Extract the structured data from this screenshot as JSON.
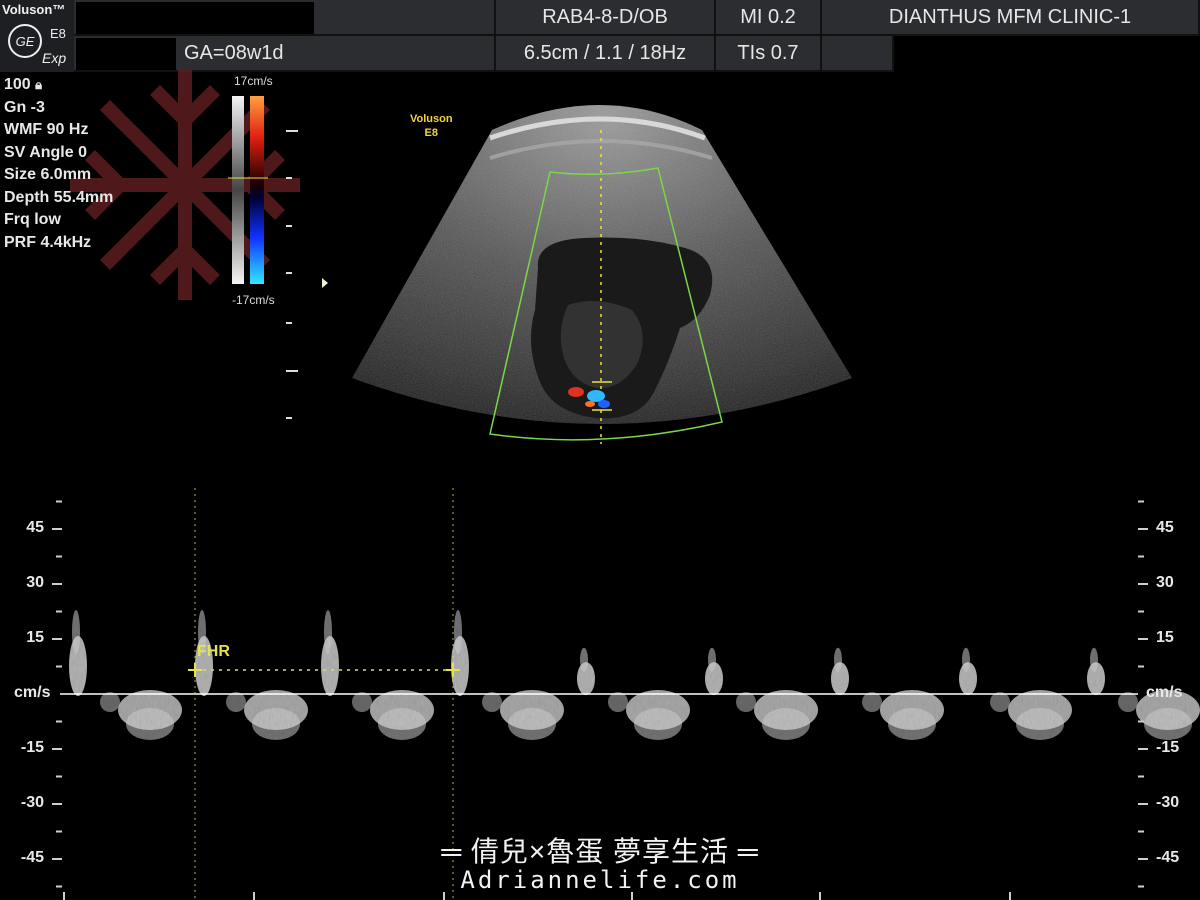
{
  "header": {
    "brand_name": "Voluson™",
    "brand_model": "E8",
    "brand_mode": "Exp",
    "logo_text": "GE",
    "ga": "GA=08w1d",
    "probe": "RAB4-8-D/OB",
    "probe_params": "6.5cm / 1.1 / 18Hz",
    "mi": "MI  0.2",
    "tis": "TIs  0.7",
    "clinic": "DIANTHUS MFM CLINIC-1"
  },
  "params": [
    "100",
    "Gn  -3",
    "WMF 90 Hz",
    "SV Angle  0",
    "Size  6.0mm",
    "Depth 55.4mm",
    "Frq low",
    "PRF  4.4kHz"
  ],
  "colorbar": {
    "top_label": "17cm/s",
    "bottom_label": "-17cm/s"
  },
  "image_mark": {
    "line1": "Voluson",
    "line2": "E8"
  },
  "doppler": {
    "unit_label": "cm/s",
    "ticks": [
      "45",
      "30",
      "15",
      "-15",
      "-30",
      "-45"
    ],
    "measure_label": "FHR",
    "colors": {
      "measure": "#e6e24a",
      "baseline": "#ffffff",
      "spectrum": "#d0d0d0",
      "sector": "#7bd64a"
    }
  },
  "watermark": {
    "title": "═ 倩兒×魯蛋  夢享生活 ═",
    "url": "Adriannelife.com"
  }
}
